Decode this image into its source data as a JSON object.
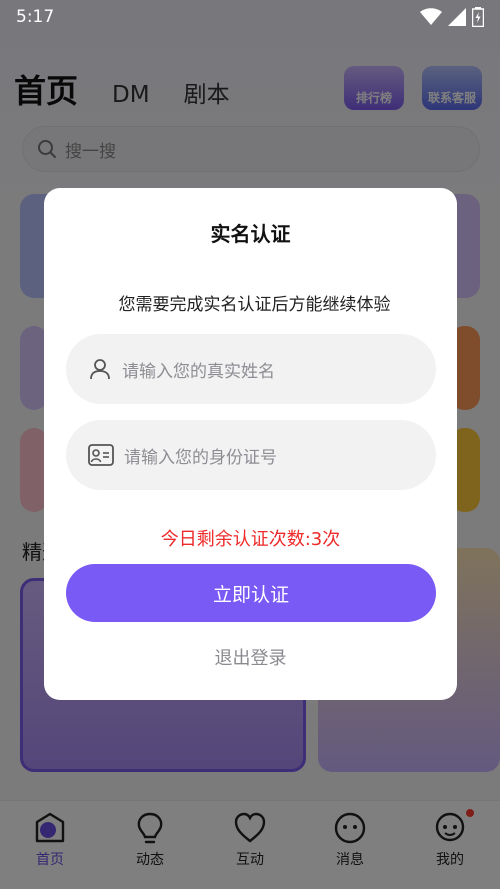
{
  "status_bar": {
    "time": "5:17"
  },
  "header": {
    "tabs": [
      {
        "label": "首页",
        "active": true
      },
      {
        "label": "DM",
        "active": false
      },
      {
        "label": "剧本",
        "active": false
      }
    ],
    "rank_label": "排行榜",
    "contact_label": "联系客服"
  },
  "search": {
    "placeholder": "搜一搜"
  },
  "section": {
    "label": "精选"
  },
  "bottom_nav": {
    "items": [
      {
        "label": "首页",
        "icon": "home-icon",
        "active": true
      },
      {
        "label": "动态",
        "icon": "bulb-icon",
        "active": false
      },
      {
        "label": "互动",
        "icon": "heart-icon",
        "active": false
      },
      {
        "label": "消息",
        "icon": "chat-icon",
        "active": false
      },
      {
        "label": "我的",
        "icon": "profile-icon",
        "active": false,
        "has_dot": true
      }
    ]
  },
  "dialog": {
    "title": "实名认证",
    "description": "您需要完成实名认证后方能继续体验",
    "name_field": {
      "placeholder": "请输入您的真实姓名",
      "icon": "person-icon"
    },
    "id_field": {
      "placeholder": "请输入您的身份证号",
      "icon": "id-card-icon"
    },
    "remaining": "今日剩余认证次数:3次",
    "confirm_label": "立即认证",
    "logout_label": "退出登录"
  },
  "colors": {
    "accent": "#7a5af5",
    "warning": "#ee2a2a",
    "overlay": "rgba(0,0,0,0.5)"
  }
}
